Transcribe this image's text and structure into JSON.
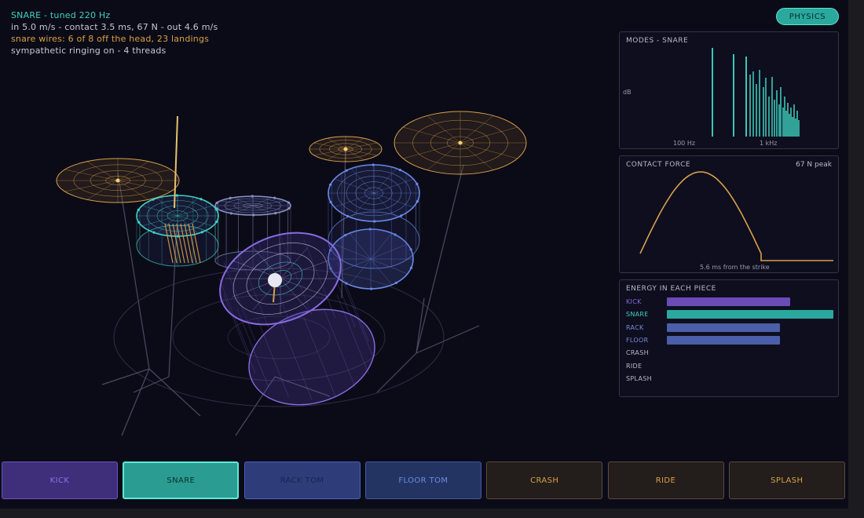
{
  "hud": {
    "line1": "SNARE  -  tuned 220 Hz",
    "line2": "in 5.0 m/s  -  contact 3.5 ms, 67 N  -  out 4.6 m/s",
    "line3": "snare wires: 6 of 8 off the head, 23 landings",
    "line4": "sympathetic ringing on  -  4 threads"
  },
  "physics_button": "PHYSICS",
  "modes": {
    "title": "MODES - SNARE",
    "ylabel": "dB",
    "tick_100": "100 Hz",
    "tick_1k": "1 kHz"
  },
  "force": {
    "title": "CONTACT FORCE",
    "peak": "67 N peak",
    "footer": "5.6 ms from the strike"
  },
  "energy": {
    "title": "ENERGY IN EACH PIECE",
    "rows": [
      {
        "name": "KICK",
        "value": 0.74,
        "color": "#6b4bb8",
        "label_color": "#8a6ae0"
      },
      {
        "name": "SNARE",
        "value": 1.0,
        "color": "#2aa89e",
        "label_color": "#3fd0c0"
      },
      {
        "name": "RACK",
        "value": 0.68,
        "color": "#4a5fa8",
        "label_color": "#7a8ad8"
      },
      {
        "name": "FLOOR",
        "value": 0.68,
        "color": "#4a5fa8",
        "label_color": "#7a8ad8"
      },
      {
        "name": "CRASH",
        "value": 0,
        "color": "#8a6a3a",
        "label_color": "#b8b8c8"
      },
      {
        "name": "RIDE",
        "value": 0,
        "color": "#8a6a3a",
        "label_color": "#b8b8c8"
      },
      {
        "name": "SPLASH",
        "value": 0,
        "color": "#8a6a3a",
        "label_color": "#b8b8c8"
      }
    ]
  },
  "toolbar": [
    {
      "label": "KICK",
      "bg": "#3f2f7a",
      "border": "#6a52c0",
      "color": "#8a70e8"
    },
    {
      "label": "SNARE",
      "bg": "#2a9c92",
      "border": "#5fe8d8",
      "color": "#0f2e2c"
    },
    {
      "label": "RACK TOM",
      "bg": "#2e3d7a",
      "border": "#4a60b8",
      "color": "#1a2450"
    },
    {
      "label": "FLOOR TOM",
      "bg": "#243462",
      "border": "#3e56a8",
      "color": "#6a8ae8"
    },
    {
      "label": "CRASH",
      "bg": "#231d1c",
      "border": "#5a4a38",
      "color": "#d8a048"
    },
    {
      "label": "RIDE",
      "bg": "#231d1c",
      "border": "#5a4a38",
      "color": "#d8a048"
    },
    {
      "label": "SPLASH",
      "bg": "#231d1c",
      "border": "#5a4a38",
      "color": "#d8a048"
    }
  ],
  "colors": {
    "snare": "#3fd0c0",
    "kick": "#8a6ae0",
    "tom": "#6a8ae8",
    "cymbal": "#d8a048"
  }
}
